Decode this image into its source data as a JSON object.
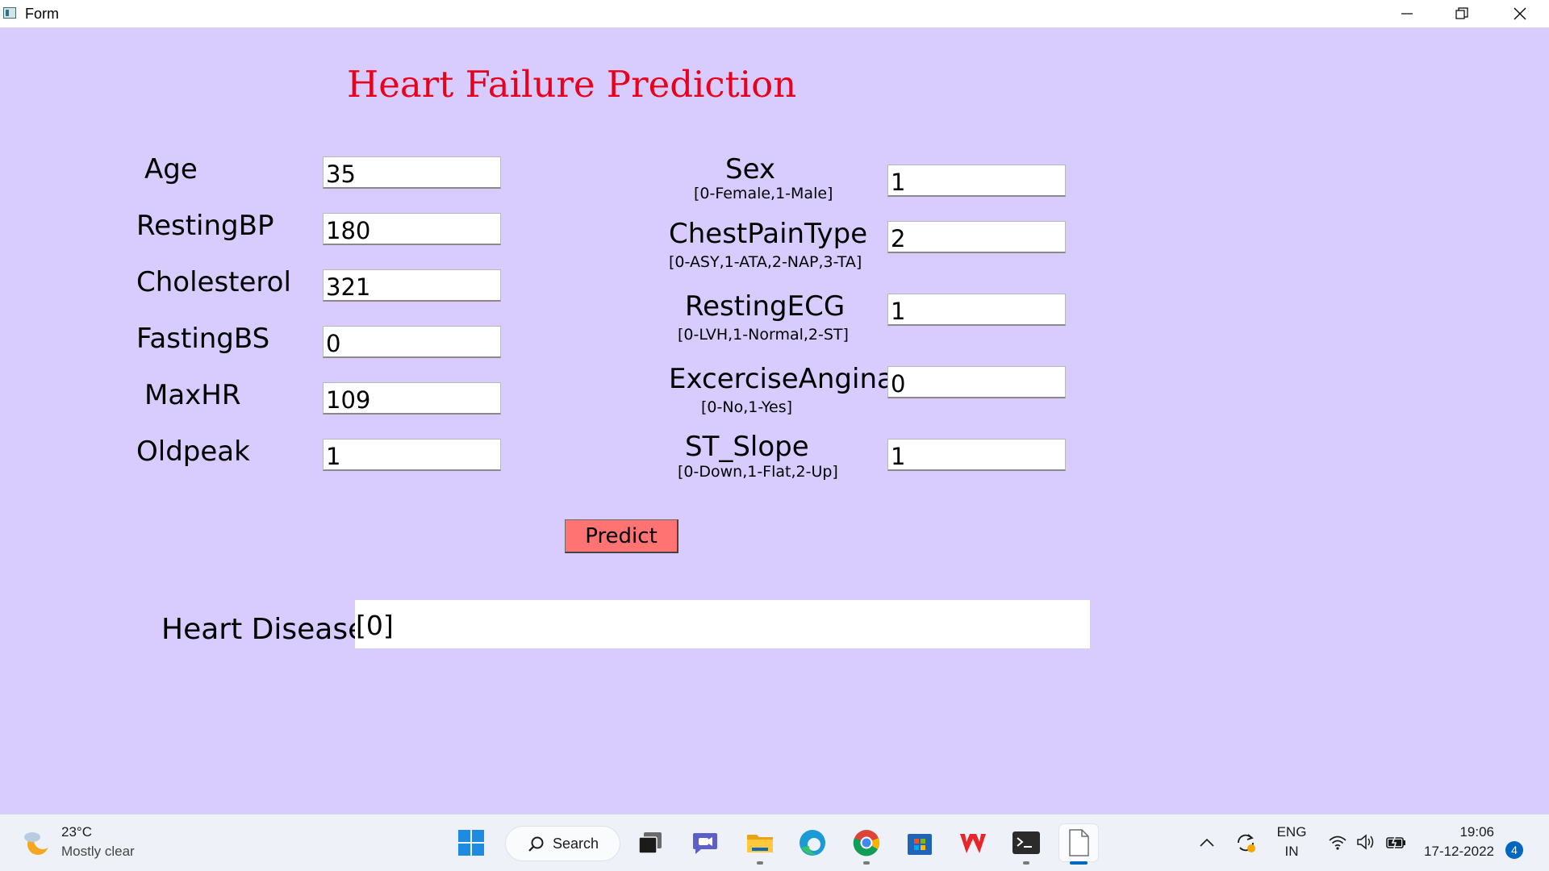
{
  "window": {
    "title": "Form",
    "controls": {
      "minimize": "minimize",
      "restore": "restore",
      "close": "close"
    }
  },
  "form": {
    "heading": "Heart Failure Prediction",
    "left_fields": [
      {
        "label": "Age",
        "value": "35"
      },
      {
        "label": "RestingBP",
        "value": "180"
      },
      {
        "label": "Cholesterol",
        "value": "321"
      },
      {
        "label": "FastingBS",
        "value": "0"
      },
      {
        "label": "MaxHR",
        "value": "109"
      },
      {
        "label": "Oldpeak",
        "value": "1"
      }
    ],
    "right_fields": [
      {
        "label": "Sex",
        "hint": "[0-Female,1-Male]",
        "value": "1"
      },
      {
        "label": "ChestPainType",
        "hint": "[0-ASY,1-ATA,2-NAP,3-TA]",
        "value": "2"
      },
      {
        "label": "RestingECG",
        "hint": "[0-LVH,1-Normal,2-ST]",
        "value": "1"
      },
      {
        "label": "ExcerciseAngina",
        "hint": "[0-No,1-Yes]",
        "value": "0"
      },
      {
        "label": "ST_Slope",
        "hint": "[0-Down,1-Flat,2-Up]",
        "value": "1"
      }
    ],
    "predict_label": "Predict",
    "result_label": "Heart Disease",
    "result_value": "[0]",
    "colors": {
      "background": "#d8ccff",
      "heading": "#e8001c",
      "predict_button": "#ff7373"
    }
  },
  "taskbar": {
    "weather": {
      "temp": "23°C",
      "desc": "Mostly clear"
    },
    "search_label": "Search",
    "apps": [
      "start-icon",
      "task-view-icon",
      "teams-chat-icon",
      "file-explorer-icon",
      "edge-icon",
      "chrome-icon",
      "microsoft-store-icon",
      "wps-office-icon",
      "terminal-icon",
      "notepad-icon"
    ],
    "tray": {
      "lang_line1": "ENG",
      "lang_line2": "IN",
      "time": "19:06",
      "date": "17-12-2022",
      "notifications": "4"
    }
  }
}
